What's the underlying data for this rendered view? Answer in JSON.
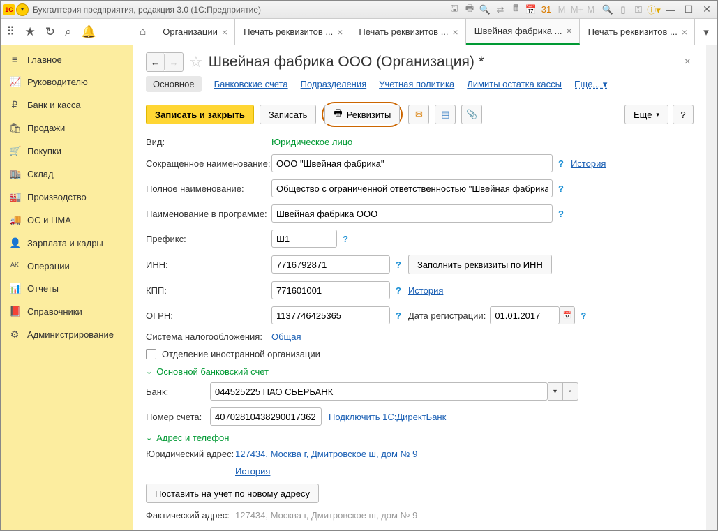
{
  "titlebar": {
    "title": "Бухгалтерия предприятия, редакция 3.0  (1С:Предприятие)"
  },
  "tabs": [
    {
      "label": "Организации"
    },
    {
      "label": "Печать реквизитов ..."
    },
    {
      "label": "Печать реквизитов ..."
    },
    {
      "label": "Швейная фабрика ...",
      "active": true
    },
    {
      "label": "Печать реквизитов ..."
    }
  ],
  "sidebar": [
    {
      "icon": "≡",
      "label": "Главное"
    },
    {
      "icon": "📈",
      "label": "Руководителю"
    },
    {
      "icon": "₽",
      "label": "Банк и касса"
    },
    {
      "icon": "🛍",
      "label": "Продажи"
    },
    {
      "icon": "🛒",
      "label": "Покупки"
    },
    {
      "icon": "🏬",
      "label": "Склад"
    },
    {
      "icon": "🏭",
      "label": "Производство"
    },
    {
      "icon": "🚚",
      "label": "ОС и НМА"
    },
    {
      "icon": "👤",
      "label": "Зарплата и кадры"
    },
    {
      "icon": "ᴬᴷ",
      "label": "Операции"
    },
    {
      "icon": "📊",
      "label": "Отчеты"
    },
    {
      "icon": "📕",
      "label": "Справочники"
    },
    {
      "icon": "⚙",
      "label": "Администрирование"
    }
  ],
  "page": {
    "title": "Швейная фабрика ООО (Организация) *",
    "section_tabs": {
      "main": "Основное",
      "bank": "Банковские счета",
      "dept": "Подразделения",
      "policy": "Учетная политика",
      "limits": "Лимиты остатка кассы",
      "more": "Еще..."
    },
    "actions": {
      "save_close": "Записать и закрыть",
      "save": "Записать",
      "details": "Реквизиты",
      "more": "Еще"
    },
    "fields": {
      "type_label": "Вид:",
      "type_value": "Юридическое лицо",
      "short_name_label": "Сокращенное наименование:",
      "short_name_value": "ООО \"Швейная фабрика\"",
      "history": "История",
      "full_name_label": "Полное наименование:",
      "full_name_value": "Общество с ограниченной ответственностью \"Швейная фабрика\"",
      "prog_name_label": "Наименование в программе:",
      "prog_name_value": "Швейная фабрика ООО",
      "prefix_label": "Префикс:",
      "prefix_value": "Ш1",
      "inn_label": "ИНН:",
      "inn_value": "7716792871",
      "fill_by_inn": "Заполнить реквизиты по ИНН",
      "kpp_label": "КПП:",
      "kpp_value": "771601001",
      "ogrn_label": "ОГРН:",
      "ogrn_value": "1137746425365",
      "reg_date_label": "Дата регистрации:",
      "reg_date_value": "01.01.2017",
      "tax_label": "Система налогообложения:",
      "tax_value": "Общая",
      "foreign_label": "Отделение иностранной организации"
    },
    "bank_section": {
      "title": "Основной банковский счет",
      "bank_label": "Банк:",
      "bank_value": "044525225 ПАО СБЕРБАНК",
      "acc_label": "Номер счета:",
      "acc_value": "40702810438290017362",
      "direct_bank": "Подключить 1С:ДиректБанк"
    },
    "addr_section": {
      "title": "Адрес и телефон",
      "legal_label": "Юридический адрес:",
      "legal_value": "127434, Москва г, Дмитровское ш, дом № 9",
      "history": "История",
      "register_btn": "Поставить на учет по новому адресу",
      "actual_label": "Фактический адрес:",
      "actual_value": "127434, Москва г, Дмитровское ш, дом № 9"
    }
  }
}
